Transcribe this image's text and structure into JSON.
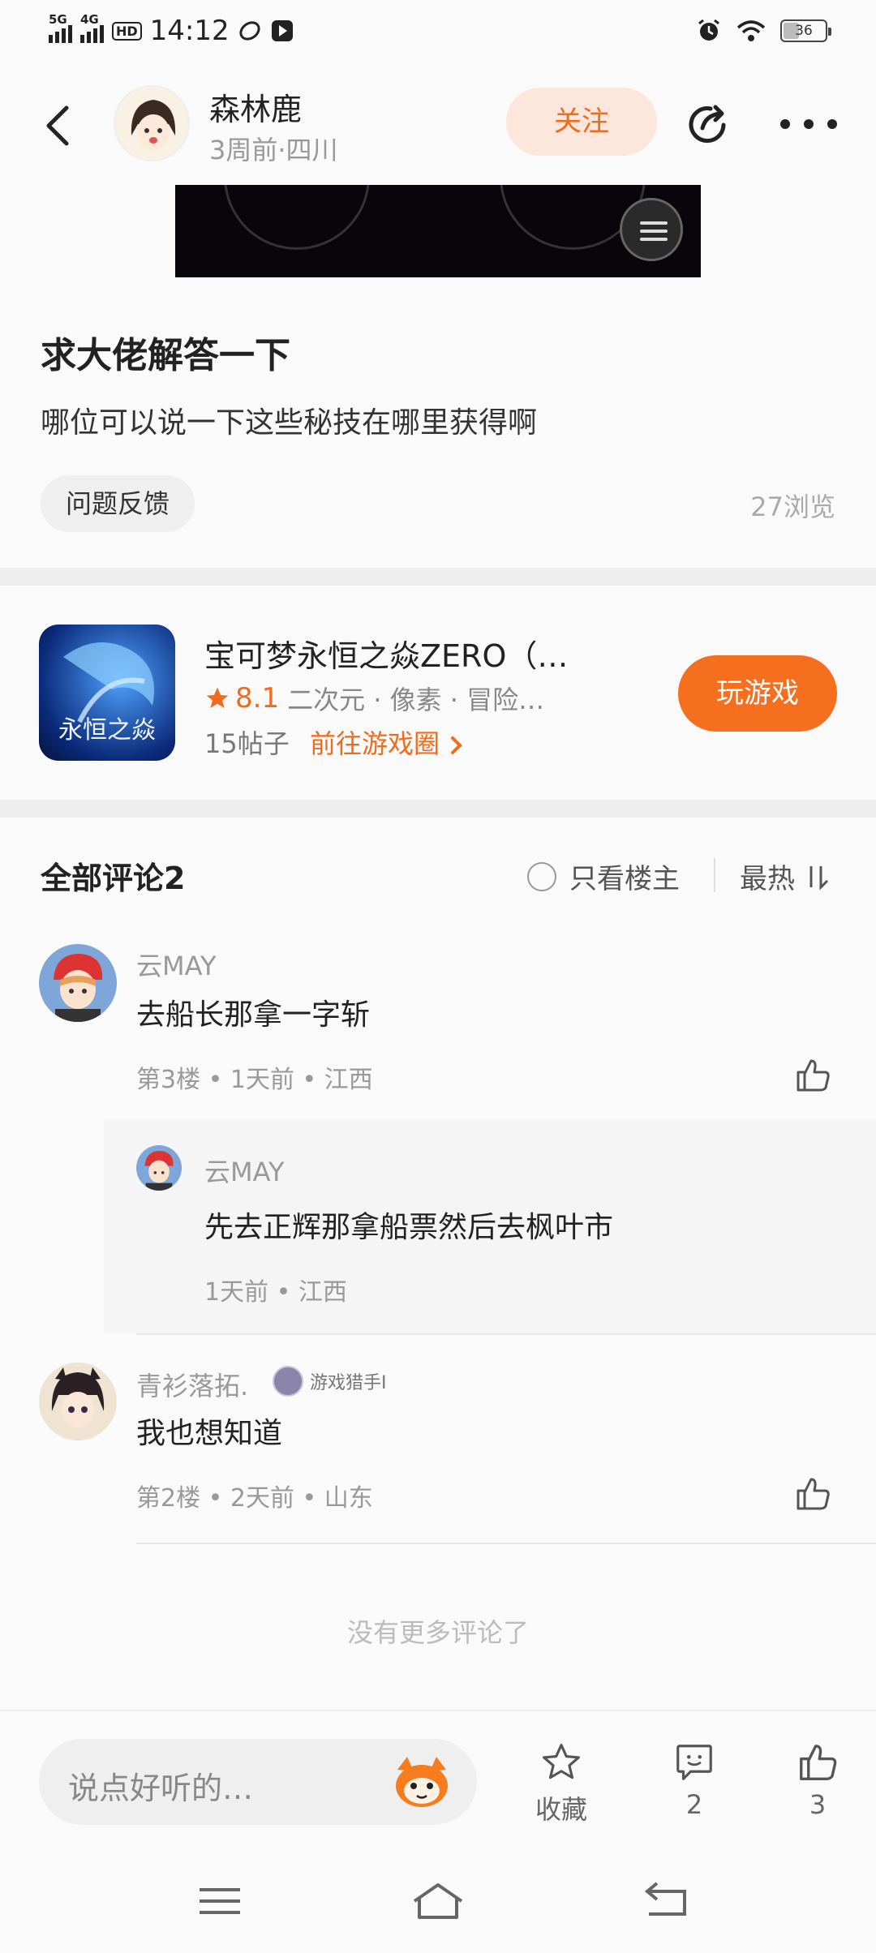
{
  "status_bar": {
    "network1": "5G",
    "network2": "4G",
    "hd": "HD",
    "time": "14:12",
    "battery": "36"
  },
  "header": {
    "author_name": "森林鹿",
    "author_meta": "3周前·四川",
    "follow_label": "关注"
  },
  "post": {
    "title": "求大佬解答一下",
    "body": "哪位可以说一下这些秘技在哪里获得啊",
    "tag": "问题反馈",
    "views": "27浏览"
  },
  "game": {
    "name": "宝可梦永恒之焱ZERO（…",
    "score": "8.1",
    "genres": "二次元 · 像素 · 冒险…",
    "posts": "15帖子",
    "link_label": "前往游戏圈",
    "play_label": "玩游戏",
    "icon_text": "永恒之焱"
  },
  "comments_header": {
    "title": "全部评论2",
    "only_host": "只看楼主",
    "sort": "最热"
  },
  "comments": [
    {
      "user": "云MAY",
      "text": "去船长那拿一字斩",
      "meta": "第3楼 • 1天前 • 江西",
      "reply": {
        "user": "云MAY",
        "text": "先去正辉那拿船票然后去枫叶市",
        "meta": "1天前 • 江西"
      }
    },
    {
      "user": "青衫落拓.",
      "badge": "游戏猎手Ⅰ",
      "text": "我也想知道",
      "meta": "第2楼 • 2天前 • 山东"
    }
  ],
  "no_more": "没有更多评论了",
  "bottom_bar": {
    "placeholder": "说点好听的…",
    "collect_label": "收藏",
    "comment_count": "2",
    "like_count": "3"
  },
  "colors": {
    "accent": "#f56f1f",
    "follow_bg": "#fde6dc"
  }
}
